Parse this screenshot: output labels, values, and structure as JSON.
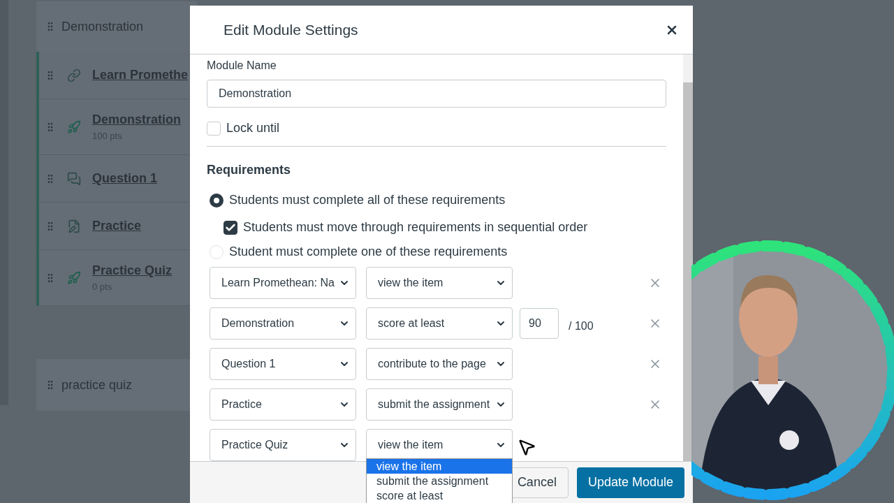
{
  "background": {
    "module": {
      "title": "Demonstration",
      "items": [
        {
          "title": "Learn Promethe",
          "kind": "link"
        },
        {
          "title": "Demonstration",
          "points": "100 pts",
          "kind": "quiz"
        },
        {
          "title": "Question 1",
          "kind": "discussion"
        },
        {
          "title": "Practice",
          "kind": "assignment"
        },
        {
          "title": "Practice Quiz",
          "points": "0 pts",
          "kind": "quiz"
        }
      ]
    },
    "module_2": {
      "title": "practice quiz"
    }
  },
  "dialog": {
    "title": "Edit Module Settings",
    "module_name": {
      "label": "Module Name",
      "value": "Demonstration"
    },
    "lock_until": {
      "label": "Lock until",
      "checked": false
    },
    "requirements": {
      "heading": "Requirements",
      "options": [
        {
          "label": "Students must complete all of these requirements",
          "selected": true
        },
        {
          "label": "Student must complete one of these requirements",
          "selected": false
        }
      ],
      "sequential": {
        "label": "Students must move through requirements in sequential order",
        "checked": true
      },
      "rows": [
        {
          "item": "Learn Promethean: Na",
          "action": "view the item"
        },
        {
          "item": "Demonstration",
          "action": "score at least",
          "score": "90",
          "max": "/ 100"
        },
        {
          "item": "Question 1",
          "action": "contribute to the page"
        },
        {
          "item": "Practice",
          "action": "submit the assignment"
        },
        {
          "item": "Practice Quiz",
          "action": "view the item"
        }
      ]
    },
    "dropdown": {
      "options": [
        {
          "label": "view the item",
          "selected": true
        },
        {
          "label": "submit the assignment",
          "selected": false
        },
        {
          "label": "score at least",
          "selected": false
        }
      ]
    },
    "buttons": {
      "cancel": "Cancel",
      "update": "Update Module"
    }
  }
}
